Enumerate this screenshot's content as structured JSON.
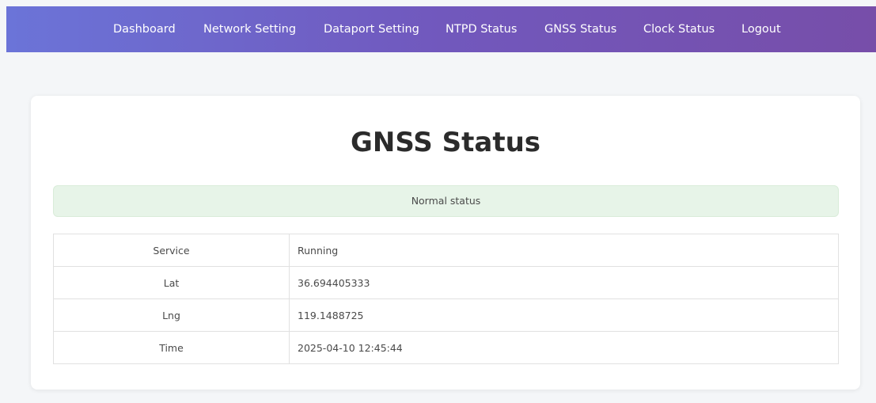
{
  "nav": {
    "items": [
      {
        "label": "Dashboard"
      },
      {
        "label": "Network Setting"
      },
      {
        "label": "Dataport Setting"
      },
      {
        "label": "NTPD Status"
      },
      {
        "label": "GNSS Status"
      },
      {
        "label": "Clock Status"
      },
      {
        "label": "Logout"
      }
    ]
  },
  "page": {
    "title": "GNSS Status",
    "status_message": "Normal status"
  },
  "table": {
    "rows": [
      {
        "key": "Service",
        "value": "Running"
      },
      {
        "key": "Lat",
        "value": "36.694405333"
      },
      {
        "key": "Lng",
        "value": "119.1488725"
      },
      {
        "key": "Time",
        "value": "2025-04-10 12:45:44"
      }
    ]
  },
  "colors": {
    "nav_gradient_start": "#6b74d8",
    "nav_gradient_end": "#774ea9",
    "status_banner_bg": "#e7f4e8"
  }
}
